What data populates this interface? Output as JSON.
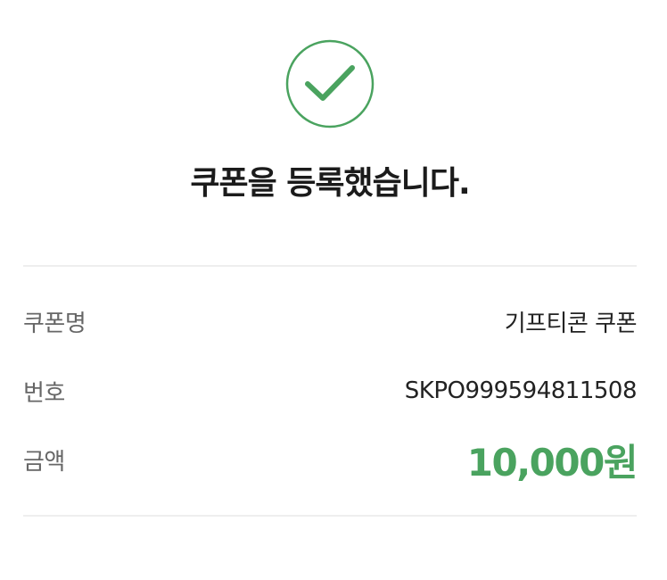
{
  "theme": {
    "accent": "#4aa35f"
  },
  "success": {
    "icon": "check-circle-icon",
    "title": "쿠폰을 등록했습니다."
  },
  "coupon": {
    "name_label": "쿠폰명",
    "name_value": "기프티콘 쿠폰",
    "number_label": "번호",
    "number_value": "SKPO999594811508",
    "amount_label": "금액",
    "amount_value": "10,000원"
  }
}
